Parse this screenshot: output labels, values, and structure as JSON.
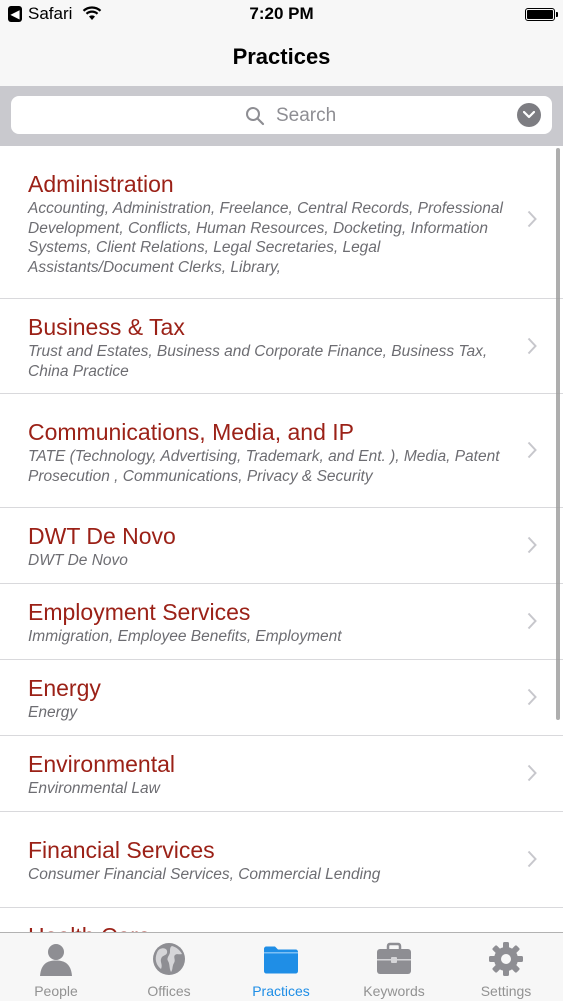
{
  "status_bar": {
    "app_label": "Safari",
    "time": "7:20 PM"
  },
  "nav": {
    "title": "Practices"
  },
  "search": {
    "placeholder": "Search"
  },
  "practices": [
    {
      "title": "Administration",
      "subtitle": "Accounting, Administration, Freelance, Central Records, Professional Development, Conflicts, Human Resources, Docketing, Information Systems, Client Relations, Legal Secretaries, Legal Assistants/Document Clerks, Library,"
    },
    {
      "title": "Business & Tax",
      "subtitle": "Trust and Estates, Business and Corporate Finance, Business Tax, China Practice"
    },
    {
      "title": "Communications, Media, and IP",
      "subtitle": "TATE (Technology, Advertising, Trademark, and Ent. ), Media, Patent Prosecution , Communications, Privacy & Security"
    },
    {
      "title": "DWT De Novo",
      "subtitle": "DWT De Novo"
    },
    {
      "title": "Employment Services",
      "subtitle": "Immigration, Employee Benefits, Employment"
    },
    {
      "title": "Energy",
      "subtitle": "Energy"
    },
    {
      "title": "Environmental",
      "subtitle": "Environmental Law"
    },
    {
      "title": "Financial Services",
      "subtitle": "Consumer Financial Services, Commercial Lending"
    },
    {
      "title": "Health Care",
      "subtitle": ""
    }
  ],
  "tabs": [
    {
      "label": "People",
      "icon": "person-icon"
    },
    {
      "label": "Offices",
      "icon": "globe-icon"
    },
    {
      "label": "Practices",
      "icon": "folder-icon",
      "active": true
    },
    {
      "label": "Keywords",
      "icon": "briefcase-icon"
    },
    {
      "label": "Settings",
      "icon": "gear-icon"
    }
  ],
  "colors": {
    "title_red": "#9b2117",
    "tab_active": "#1f8ee6",
    "tab_inactive": "#929292"
  }
}
